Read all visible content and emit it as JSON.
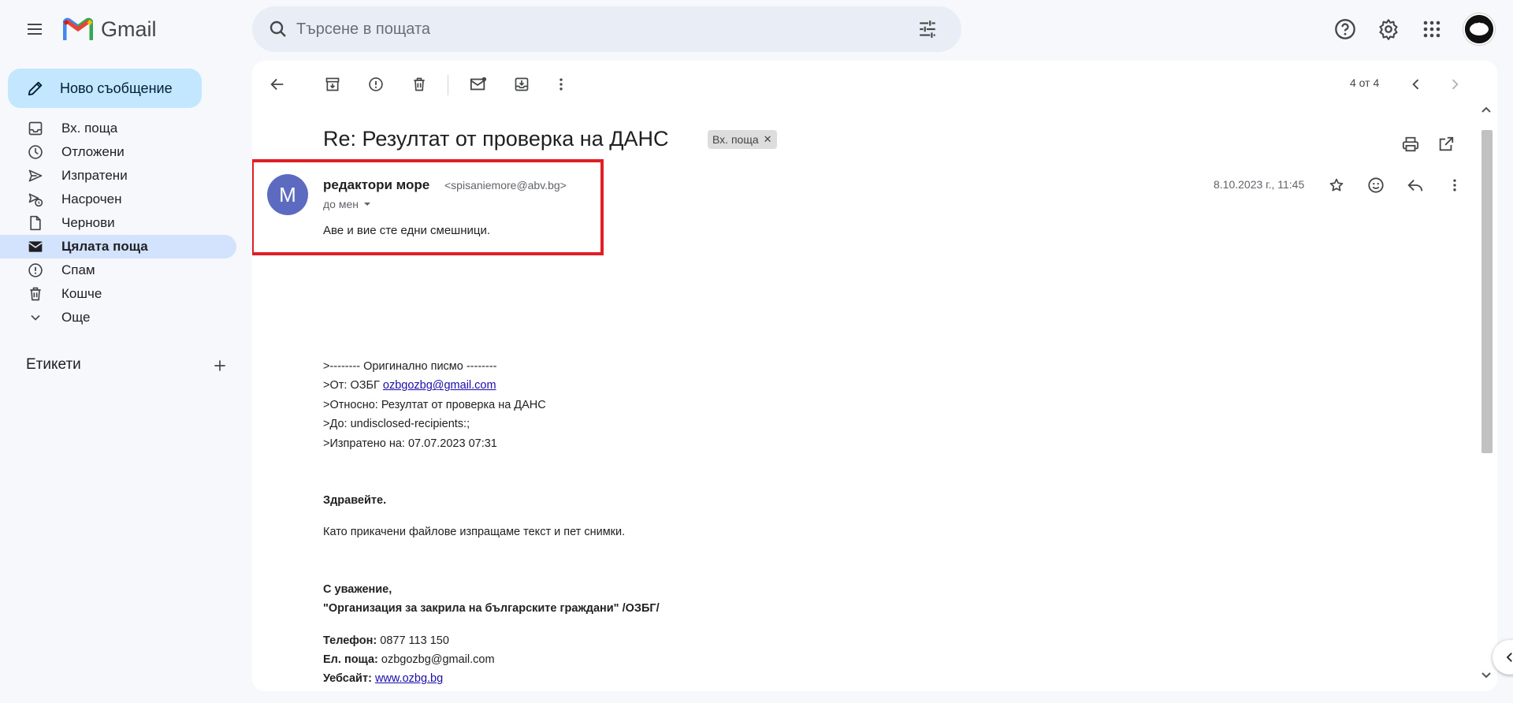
{
  "app": {
    "name": "Gmail"
  },
  "search": {
    "placeholder": "Търсене в пощата"
  },
  "compose": {
    "label": "Ново съобщение"
  },
  "sidebar": {
    "items": [
      {
        "label": "Вх. поща",
        "icon": "inbox-icon"
      },
      {
        "label": "Отложени",
        "icon": "clock-icon"
      },
      {
        "label": "Изпратени",
        "icon": "send-icon"
      },
      {
        "label": "Насрочен",
        "icon": "scheduled-send-icon"
      },
      {
        "label": "Чернови",
        "icon": "draft-icon"
      },
      {
        "label": "Цялата поща",
        "icon": "all-mail-icon",
        "active": true
      },
      {
        "label": "Спам",
        "icon": "spam-icon"
      },
      {
        "label": "Кошче",
        "icon": "trash-icon"
      },
      {
        "label": "Още",
        "icon": "chevron-down-icon"
      }
    ],
    "labels_title": "Етикети"
  },
  "toolbar": {
    "pager": "4 от 4"
  },
  "email": {
    "subject": "Re: Резултат от проверка на ДАНС",
    "label_chip": "Вх. поща",
    "avatar_letter": "M",
    "sender_name": "редактори море",
    "sender_email": "<spisaniemore@abv.bg>",
    "to": "до мен",
    "date": "8.10.2023 г., 11:45",
    "snippet": "Аве и вие сте едни смешници.",
    "body": {
      "l1": ">-------- Оригинално писмо --------",
      "l2_prefix": ">От: ОЗБГ ",
      "l2_link": "ozbgozbg@gmail.com",
      "l3": ">Относно: Резултат от проверка на ДАНС",
      "l4": ">До: undisclosed-recipients:;",
      "l5": ">Изпратено на: 07.07.2023 07:31",
      "greeting": "Здравейте.",
      "p1": "Като прикачени файлове изпращаме текст и пет снимки.",
      "regards": "С уважение,",
      "org": "\"Организация за закрила на българските граждани\" /ОЗБГ/",
      "phone_label": "Телефон:",
      "phone": " 0877 113 150",
      "email_label": "Ел. поща:",
      "email": " ozbgozbg@gmail.com",
      "web_label": "Уебсайт:",
      "web": "www.ozbg.bg"
    }
  },
  "colors": {
    "accent": "#c2e7ff",
    "highlight": "#e01e26",
    "avatar": "#5c6bc0"
  }
}
